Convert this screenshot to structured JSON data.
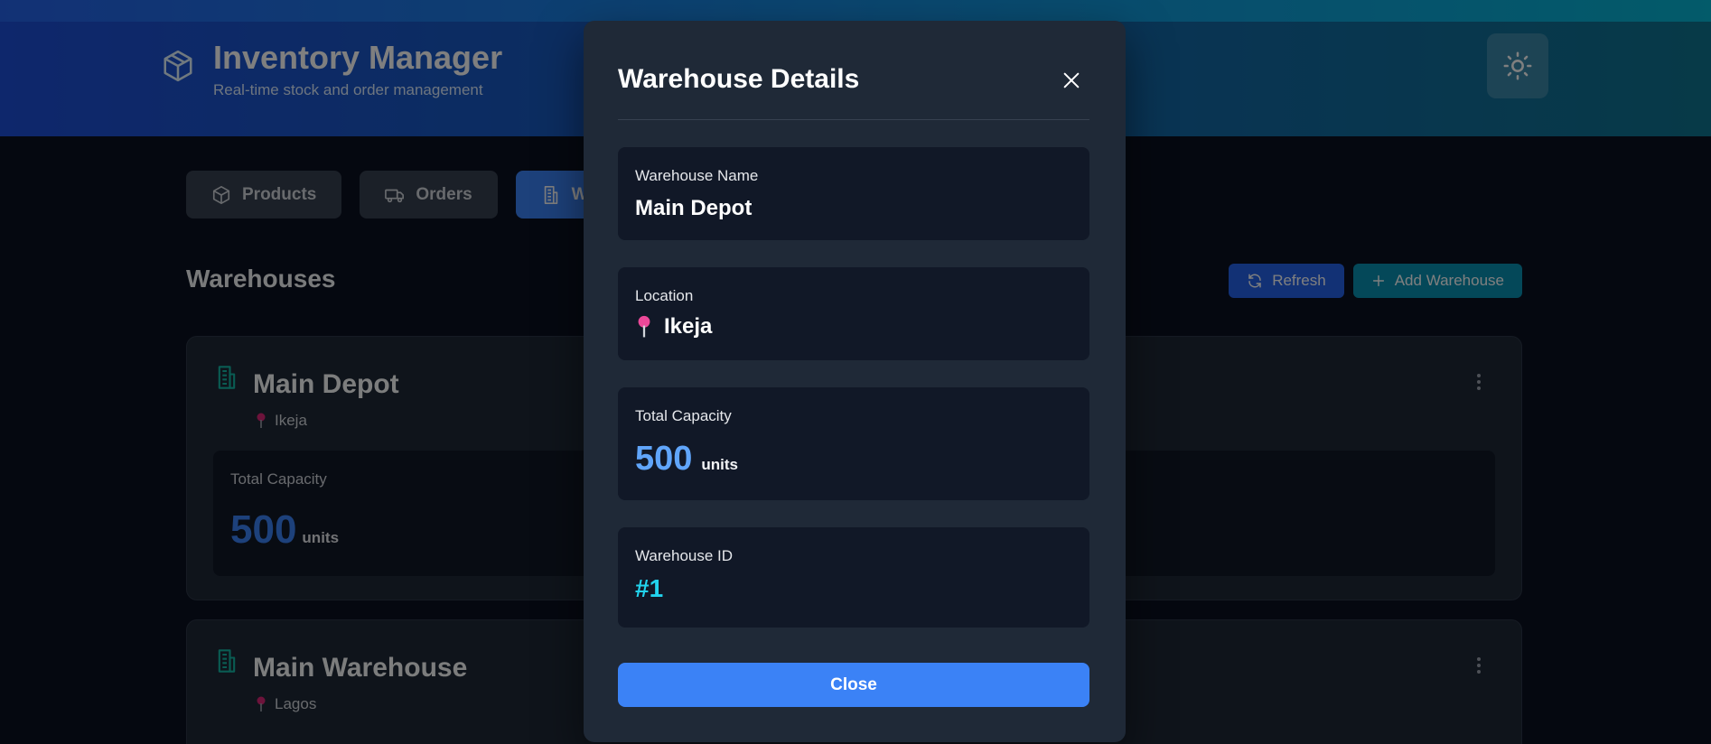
{
  "app": {
    "title": "Inventory Manager",
    "subtitle": "Real-time stock and order management",
    "theme_toggle_icon": "sun-icon"
  },
  "tabs": [
    {
      "label": "Products",
      "icon": "box-icon",
      "active": false
    },
    {
      "label": "Orders",
      "icon": "truck-icon",
      "active": false
    },
    {
      "label": "W",
      "icon": "building-icon",
      "active": true
    }
  ],
  "section": {
    "title": "Warehouses",
    "refresh_label": "Refresh",
    "add_label": "Add Warehouse"
  },
  "warehouses": [
    {
      "name": "Main Depot",
      "location": "Ikeja",
      "capacity_label": "Total Capacity",
      "capacity": "500",
      "unit": "units"
    },
    {
      "name": "Main Warehouse",
      "location": "Lagos"
    }
  ],
  "modal": {
    "title": "Warehouse Details",
    "name_label": "Warehouse Name",
    "name_value": "Main Depot",
    "location_label": "Location",
    "location_value": "Ikeja",
    "capacity_label": "Total Capacity",
    "capacity_value": "500",
    "capacity_unit": "units",
    "id_label": "Warehouse ID",
    "id_value": "#1",
    "close_label": "Close"
  },
  "colors": {
    "primary": "#3b82f6",
    "accent_cyan": "#22d3ee",
    "background": "#0b1120",
    "card": "#1f2937",
    "pin": "#db2777"
  }
}
